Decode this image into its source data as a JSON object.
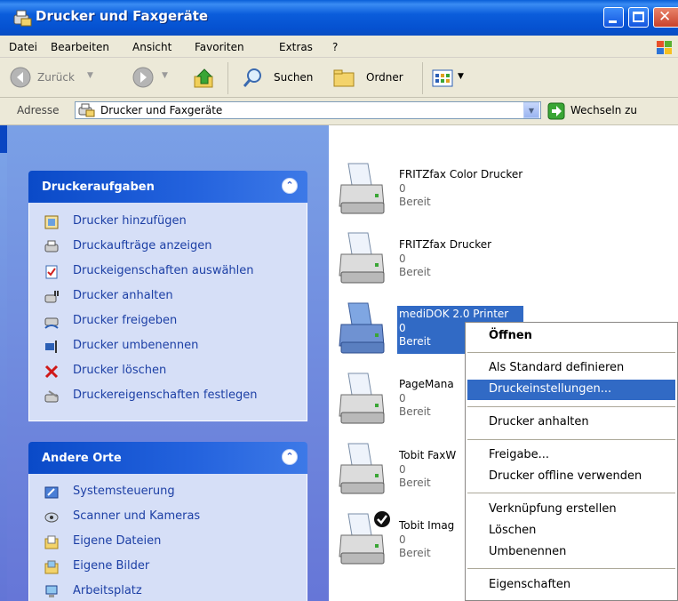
{
  "window": {
    "title": "Drucker und Faxgeräte"
  },
  "menu": [
    "Datei",
    "Bearbeiten",
    "Ansicht",
    "Favoriten",
    "Extras",
    "?"
  ],
  "toolbar": {
    "back": "Zurück",
    "search": "Suchen",
    "folders": "Ordner"
  },
  "address": {
    "label": "Adresse",
    "value": "Drucker und Faxgeräte",
    "go": "Wechseln zu"
  },
  "panels": {
    "tasks": {
      "title": "Druckeraufgaben",
      "items": [
        "Drucker hinzufügen",
        "Druckaufträge anzeigen",
        "Druckeigenschaften auswählen",
        "Drucker anhalten",
        "Drucker freigeben",
        "Drucker umbenennen",
        "Drucker löschen",
        "Druckereigenschaften festlegen"
      ]
    },
    "places": {
      "title": "Andere Orte",
      "items": [
        "Systemsteuerung",
        "Scanner und Kameras",
        "Eigene Dateien",
        "Eigene Bilder",
        "Arbeitsplatz"
      ]
    }
  },
  "printers": [
    {
      "name": "FRITZfax Color Drucker",
      "count": "0",
      "status": "Bereit"
    },
    {
      "name": "FRITZfax Drucker",
      "count": "0",
      "status": "Bereit"
    },
    {
      "name": "mediDOK 2.0 Printer",
      "count": "0",
      "status": "Bereit",
      "selected": true
    },
    {
      "name": "PageMana",
      "count": "0",
      "status": "Bereit"
    },
    {
      "name": "Tobit FaxW",
      "count": "0",
      "status": "Bereit"
    },
    {
      "name": "Tobit Imag",
      "count": "0",
      "status": "Bereit",
      "default": true
    }
  ],
  "context_menu": {
    "items": [
      "Öffnen",
      "Als Standard definieren",
      "Druckeinstellungen...",
      "Drucker anhalten",
      "Freigabe...",
      "Drucker offline verwenden",
      "Verknüpfung erstellen",
      "Löschen",
      "Umbenennen",
      "Eigenschaften"
    ],
    "highlighted": "Druckeinstellungen..."
  },
  "colors": {
    "title_blue": "#0b5ddb",
    "selection": "#316ac5",
    "left_pane": "#6d8ce0",
    "panel_body": "#d6dff7"
  }
}
